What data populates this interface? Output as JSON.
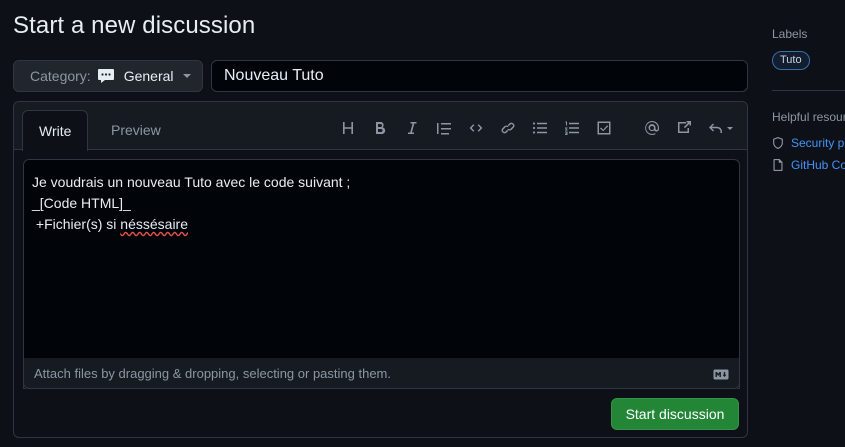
{
  "header": {
    "title": "Start a new discussion"
  },
  "category": {
    "label": "Category:",
    "value": "General"
  },
  "title_input": {
    "value": "Nouveau Tuto"
  },
  "editor": {
    "tabs": [
      {
        "label": "Write"
      },
      {
        "label": "Preview"
      }
    ],
    "toolbar": [
      "heading-icon",
      "bold-icon",
      "italic-icon",
      "quote-icon",
      "code-icon",
      "link-icon",
      "bulleted-list-icon",
      "numbered-list-icon",
      "task-list-icon",
      "mention-icon",
      "reference-icon",
      "saved-replies-icon"
    ],
    "body_lines": [
      "Je voudrais un nouveau Tuto avec le code suivant ;",
      "_[Code HTML]_",
      " +Fichier(s) si ",
      "néssésaire"
    ],
    "attach_hint": "Attach files by dragging & dropping, selecting or pasting them.",
    "markdown_badge": "markdown-icon"
  },
  "submit": {
    "label": "Start discussion"
  },
  "sidebar": {
    "labels_heading": "Labels",
    "labels": [
      "Tuto"
    ],
    "resources_heading": "Helpful resour",
    "resources": [
      {
        "icon": "shield-icon",
        "label": "Security po"
      },
      {
        "icon": "file-icon",
        "label": "GitHub Co"
      }
    ]
  },
  "colors": {
    "background": "#0d1117",
    "primary_button": "#238636",
    "link": "#4493f8",
    "label_border": "#3a6ea5"
  }
}
